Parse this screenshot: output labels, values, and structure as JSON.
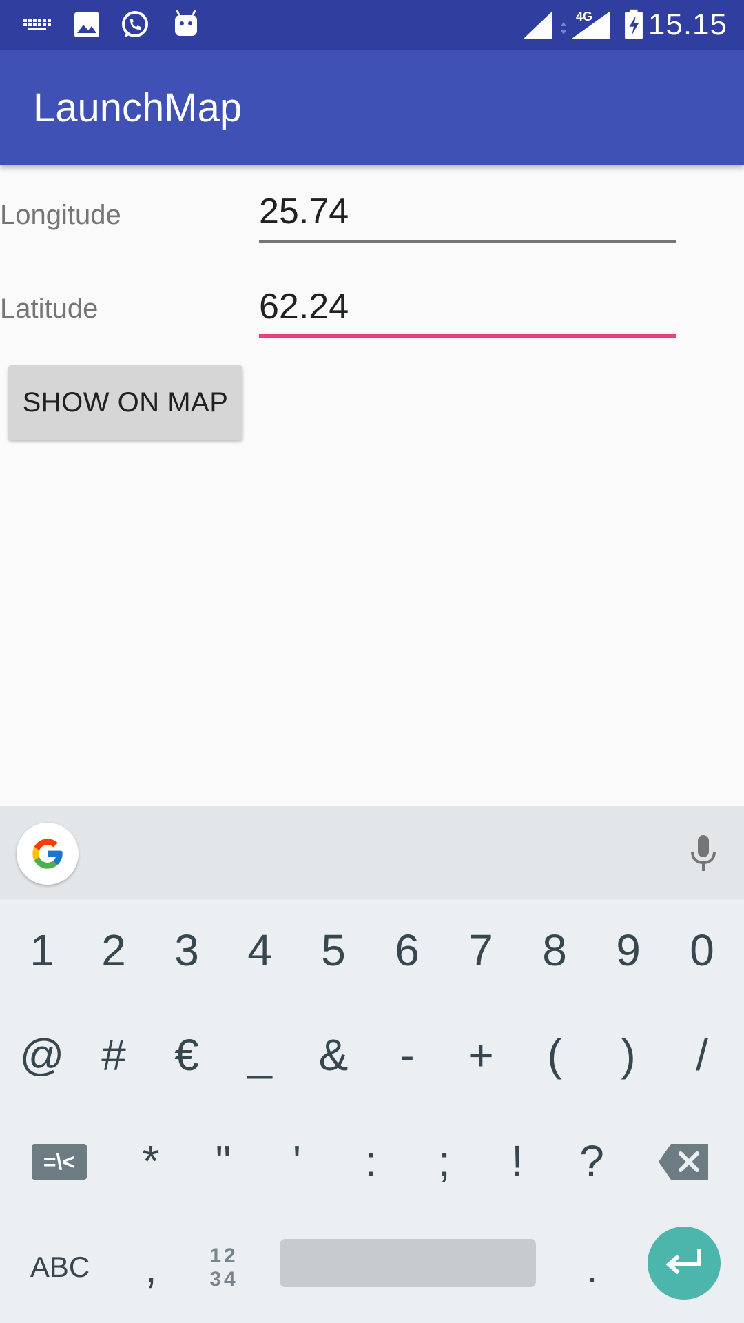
{
  "status_bar": {
    "time": "15.15",
    "network": "4G",
    "icons": [
      "keyboard-icon",
      "image-icon",
      "whatsapp-icon",
      "android-icon",
      "signal-icon",
      "signal-4g-icon",
      "battery-charging-icon"
    ]
  },
  "app_bar": {
    "title": "LaunchMap"
  },
  "form": {
    "longitude_label": "Longitude",
    "longitude_value": "25.74",
    "latitude_label": "Latitude",
    "latitude_value": "62.24",
    "show_button": "SHOW ON MAP"
  },
  "colors": {
    "status_bar": "#303f9f",
    "app_bar": "#3f51b5",
    "focused_underline": "#ec407a",
    "enter_key": "#4db6ac"
  },
  "keyboard": {
    "row1": [
      "1",
      "2",
      "3",
      "4",
      "5",
      "6",
      "7",
      "8",
      "9",
      "0"
    ],
    "row2": [
      "@",
      "#",
      "€",
      "_",
      "&",
      "-",
      "+",
      "(",
      ")",
      "/"
    ],
    "row3_symbols_key": "=\\<",
    "row3": [
      "*",
      "\"",
      "'",
      ":",
      ";",
      "!",
      "?"
    ],
    "abc_key": "ABC",
    "comma_key": ",",
    "numpad_key_top": "12",
    "numpad_key_bottom": "34",
    "period_key": "."
  }
}
